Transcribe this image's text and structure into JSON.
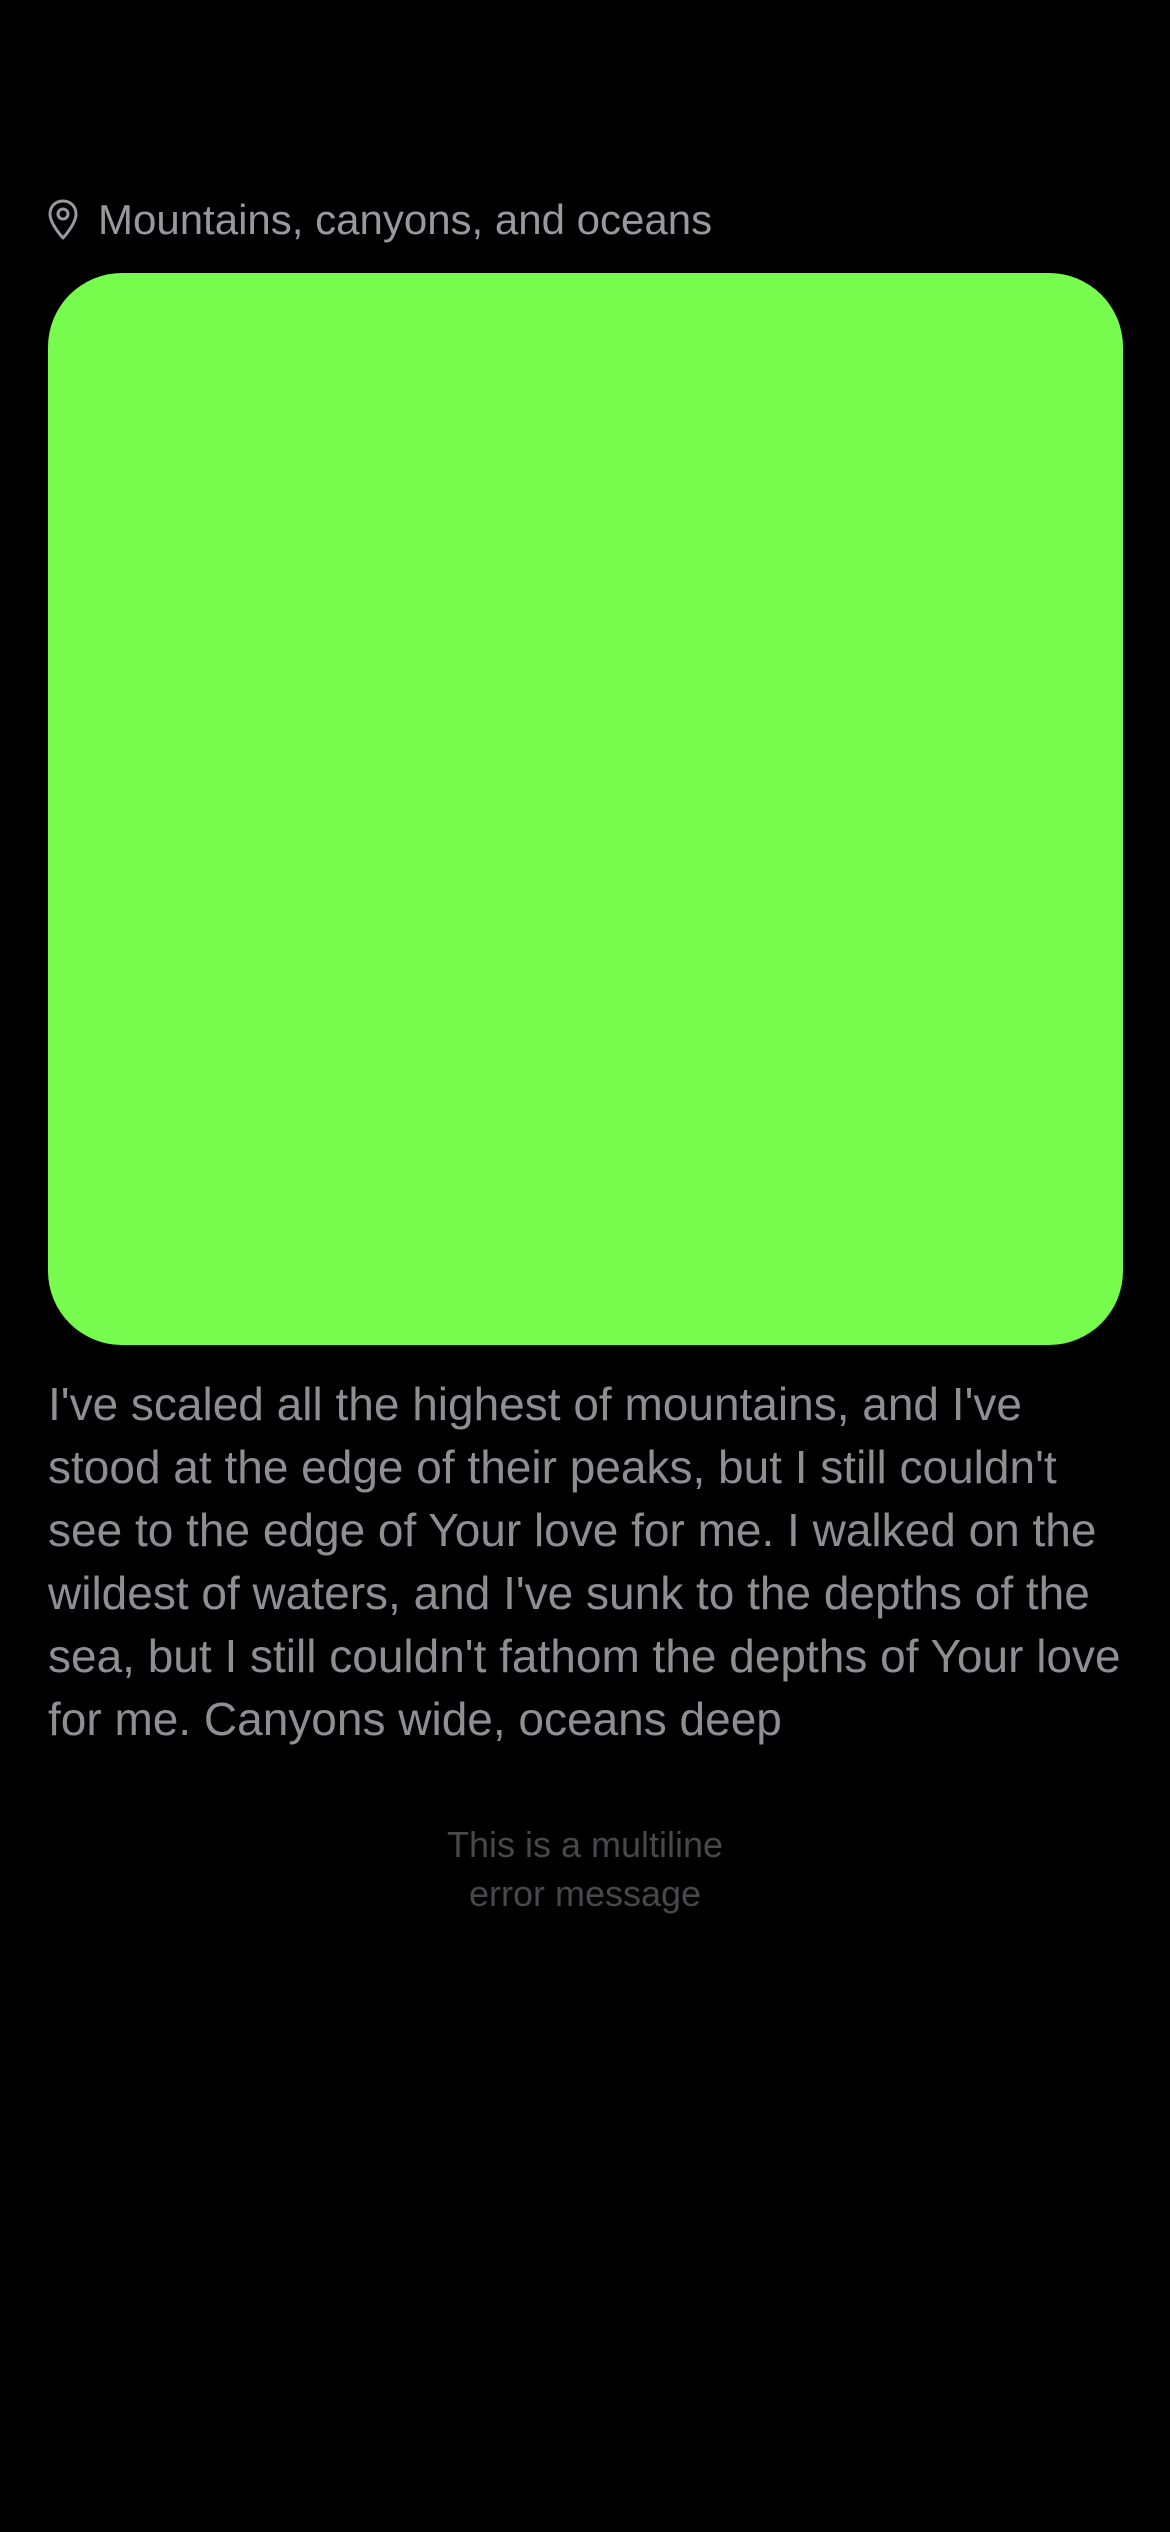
{
  "location": {
    "icon": "map-pin-icon",
    "label": "Mountains, canyons, and oceans"
  },
  "media": {
    "color": "#77fc4e"
  },
  "post": {
    "text": "I've scaled all the highest of mountains, and I've stood at the edge of their peaks, but I still couldn't see to the edge of Your love for me. I walked on the wildest of waters, and I've sunk to the depths of the sea, but I still couldn't fathom the depths of Your love for me. Canyons wide, oceans deep"
  },
  "error": {
    "line1": "This is a multiline",
    "line2": "error message"
  },
  "colors": {
    "background": "#000000",
    "text": "#8e8e93",
    "error_text": "#48484a"
  }
}
